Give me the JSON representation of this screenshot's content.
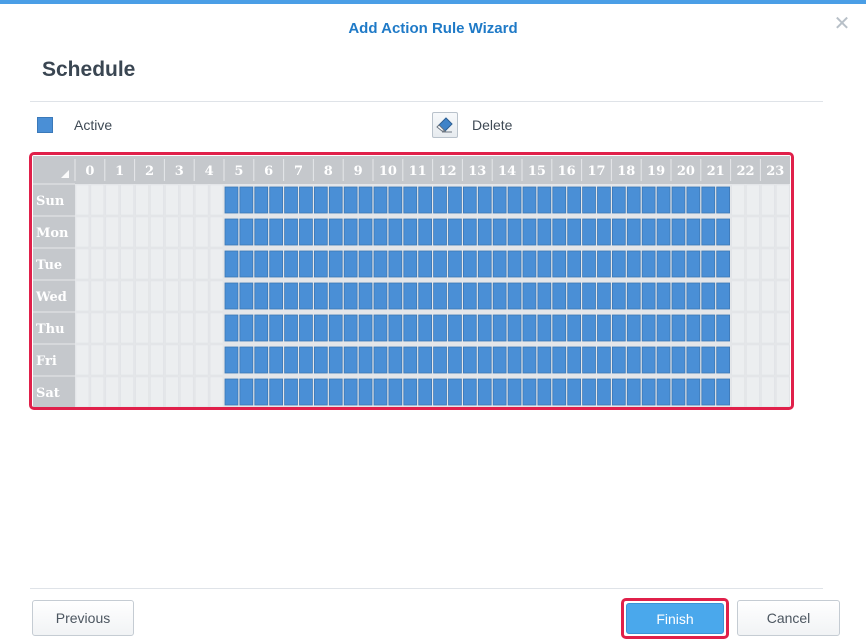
{
  "dialog": {
    "title": "Add Action Rule Wizard",
    "close_icon": "close-icon"
  },
  "page": {
    "heading": "Schedule"
  },
  "legend": {
    "active_label": "Active",
    "delete_label": "Delete",
    "active_color": "#4a8fd6",
    "delete_icon": "eraser-icon"
  },
  "schedule": {
    "hours": [
      "0",
      "1",
      "2",
      "3",
      "4",
      "5",
      "6",
      "7",
      "8",
      "9",
      "10",
      "11",
      "12",
      "13",
      "14",
      "15",
      "16",
      "17",
      "18",
      "19",
      "20",
      "21",
      "22",
      "23"
    ],
    "days": [
      "Sun",
      "Mon",
      "Tue",
      "Wed",
      "Thu",
      "Fri",
      "Sat"
    ],
    "active_color": "#4a8fd6",
    "header_color": "#c5c8cc",
    "active": {
      "Sun": [
        5,
        6,
        7,
        8,
        9,
        10,
        11,
        12,
        13,
        14,
        15,
        16,
        17,
        18,
        19,
        20,
        21
      ],
      "Mon": [
        5,
        6,
        7,
        8,
        9,
        10,
        11,
        12,
        13,
        14,
        15,
        16,
        17,
        18,
        19,
        20,
        21
      ],
      "Tue": [
        5,
        6,
        7,
        8,
        9,
        10,
        11,
        12,
        13,
        14,
        15,
        16,
        17,
        18,
        19,
        20,
        21
      ],
      "Wed": [
        5,
        6,
        7,
        8,
        9,
        10,
        11,
        12,
        13,
        14,
        15,
        16,
        17,
        18,
        19,
        20,
        21
      ],
      "Thu": [
        5,
        6,
        7,
        8,
        9,
        10,
        11,
        12,
        13,
        14,
        15,
        16,
        17,
        18,
        19,
        20,
        21
      ],
      "Fri": [
        5,
        6,
        7,
        8,
        9,
        10,
        11,
        12,
        13,
        14,
        15,
        16,
        17,
        18,
        19,
        20,
        21
      ],
      "Sat": [
        5,
        6,
        7,
        8,
        9,
        10,
        11,
        12,
        13,
        14,
        15,
        16,
        17,
        18,
        19,
        20,
        21
      ]
    }
  },
  "footer": {
    "previous_label": "Previous",
    "finish_label": "Finish",
    "cancel_label": "Cancel"
  },
  "colors": {
    "accent": "#4a9ee6",
    "title": "#1f7ac7",
    "highlight": "#e0204a",
    "primary_button": "#4aa8ec"
  }
}
